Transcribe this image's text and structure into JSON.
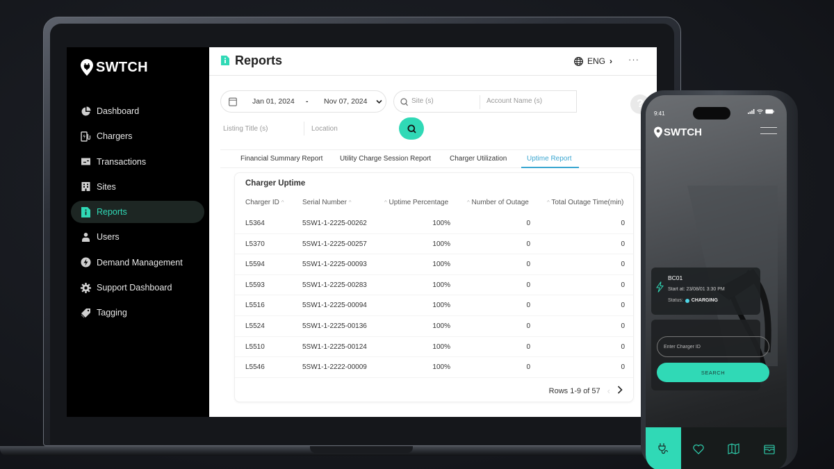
{
  "colors": {
    "accent": "#30d9b6",
    "active_tab": "#3aa6d1",
    "sidebar_bg": "#000000"
  },
  "sidebar": {
    "logo": "SWTCH",
    "items": [
      {
        "label": "Dashboard",
        "icon": "pie-chart-icon",
        "active": false
      },
      {
        "label": "Chargers",
        "icon": "charger-icon",
        "active": false
      },
      {
        "label": "Transactions",
        "icon": "transactions-icon",
        "active": false
      },
      {
        "label": "Sites",
        "icon": "building-icon",
        "active": false
      },
      {
        "label": "Reports",
        "icon": "report-icon",
        "active": true
      },
      {
        "label": "Users",
        "icon": "user-icon",
        "active": false
      },
      {
        "label": "Demand Management",
        "icon": "bolt-circle-icon",
        "active": false
      },
      {
        "label": "Support Dashboard",
        "icon": "gear-icon",
        "active": false
      },
      {
        "label": "Tagging",
        "icon": "tag-icon",
        "active": false
      }
    ]
  },
  "header": {
    "title": "Reports",
    "language": "ENG",
    "more": "···"
  },
  "filters": {
    "start_date": "Jan 01, 2024",
    "date_separator": "-",
    "end_date": "Nov 07, 2024",
    "site_placeholder": "Site (s)",
    "account_placeholder": "Account Name (s)",
    "listing_placeholder": "Listing Title (s)",
    "location_placeholder": "Location",
    "help": "?"
  },
  "tabs": [
    {
      "label": "Financial Summary Report",
      "active": false
    },
    {
      "label": "Utility Charge Session Report",
      "active": false
    },
    {
      "label": "Charger Utilization",
      "active": false
    },
    {
      "label": "Uptime Report",
      "active": true
    }
  ],
  "table": {
    "title": "Charger Uptime",
    "columns": [
      "Charger ID",
      "Serial Number",
      "Uptime Percentage",
      "Number of Outage",
      "Total Outage Time(min)"
    ],
    "rows": [
      [
        "L5364",
        "5SW1-1-2225-00262",
        "100%",
        "0",
        "0"
      ],
      [
        "L5370",
        "5SW1-1-2225-00257",
        "100%",
        "0",
        "0"
      ],
      [
        "L5594",
        "5SW1-1-2225-00093",
        "100%",
        "0",
        "0"
      ],
      [
        "L5593",
        "5SW1-1-2225-00283",
        "100%",
        "0",
        "0"
      ],
      [
        "L5516",
        "5SW1-1-2225-00094",
        "100%",
        "0",
        "0"
      ],
      [
        "L5524",
        "5SW1-1-2225-00136",
        "100%",
        "0",
        "0"
      ],
      [
        "L5510",
        "5SW1-1-2225-00124",
        "100%",
        "0",
        "0"
      ],
      [
        "L5546",
        "5SW1-1-2222-00009",
        "100%",
        "0",
        "0"
      ]
    ],
    "pagination": "Rows 1-9 of 57"
  },
  "phone": {
    "time": "9:41",
    "logo": "SWTCH",
    "session": {
      "charger_id": "BC01",
      "start": "Start at: 23/08/01 3:30 PM",
      "status_label": "Status:",
      "status_value": "CHARGING"
    },
    "charger_input_placeholder": "Enter Charger ID",
    "search_button": "SEARCH",
    "tabbar": [
      "plug-icon",
      "heart-icon",
      "map-icon",
      "wallet-icon"
    ]
  }
}
